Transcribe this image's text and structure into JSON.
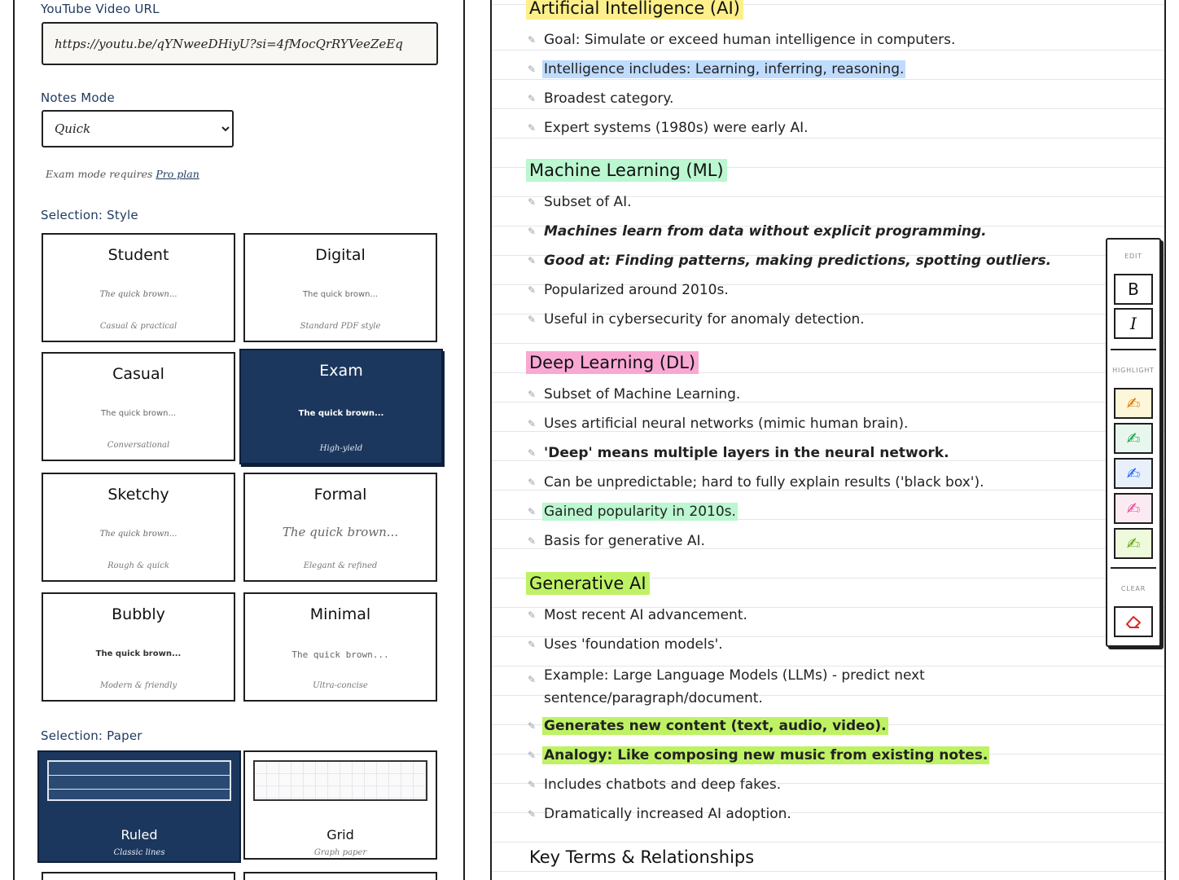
{
  "settings": {
    "url_label": "YouTube Video URL",
    "url_value": "https://youtu.be/qYNweeDHiyU?si=4fMocQrRYVeeZeEq",
    "mode_label": "Notes Mode",
    "mode_value": "Quick",
    "mode_note_prefix": "Exam mode requires",
    "mode_note_link": "Pro plan",
    "style_label": "Selection: Style",
    "paper_label": "Selection: Paper"
  },
  "styles": [
    {
      "name": "Student",
      "sample": "The quick brown...",
      "desc": "Casual & practical"
    },
    {
      "name": "Digital",
      "sample": "The quick brown...",
      "desc": "Standard PDF style"
    },
    {
      "name": "Casual",
      "sample": "The quick brown...",
      "desc": "Conversational"
    },
    {
      "name": "Exam",
      "sample": "The quick brown...",
      "desc": "High-yield",
      "selected": true
    },
    {
      "name": "Sketchy",
      "sample": "The quick brown...",
      "desc": "Rough & quick"
    },
    {
      "name": "Formal",
      "sample": "The quick brown...",
      "desc": "Elegant & refined"
    },
    {
      "name": "Bubbly",
      "sample": "The quick brown...",
      "desc": "Modern & friendly"
    },
    {
      "name": "Minimal",
      "sample": "The quick brown...",
      "desc": "Ultra-concise"
    }
  ],
  "papers": [
    {
      "name": "Ruled",
      "desc": "Classic lines",
      "selected": true
    },
    {
      "name": "Grid",
      "desc": "Graph paper"
    }
  ],
  "notes": {
    "h1": "Artificial Intelligence (AI)",
    "ai": [
      "Goal: Simulate or exceed human intelligence in computers.",
      "Intelligence includes: Learning, inferring, reasoning.",
      "Broadest category.",
      "Expert systems (1980s) were early AI."
    ],
    "h2": "Machine Learning (ML)",
    "ml": [
      "Subset of AI.",
      "Machines learn from data without explicit programming.",
      "Good at: Finding patterns, making predictions, spotting outliers.",
      "Popularized around 2010s.",
      "Useful in cybersecurity for anomaly detection."
    ],
    "h3": "Deep Learning (DL)",
    "dl": [
      "Subset of Machine Learning.",
      "Uses artificial neural networks (mimic human brain).",
      "'Deep' means multiple layers in the neural network.",
      "Can be unpredictable; hard to fully explain results ('black box').",
      "Gained popularity in 2010s.",
      "Basis for generative AI."
    ],
    "h4": "Generative AI",
    "gen": [
      "Most recent AI advancement.",
      "Uses 'foundation models'.",
      "Example: Large Language Models (LLMs) - predict next sentence/paragraph/document.",
      "Generates new content (text, audio, video).",
      "Analogy: Like composing new music from existing notes.",
      "Includes chatbots and deep fakes.",
      "Dramatically increased AI adoption."
    ],
    "h5": "Key Terms & Relationships"
  },
  "toolbar": {
    "edit_label": "EDIT",
    "bold": "B",
    "italic": "I",
    "highlight_label": "HIGHLIGHT",
    "clear_label": "CLEAR"
  },
  "colors": {
    "accent_navy": "#1c375e",
    "hl_yellow": "#fdf08a",
    "hl_green": "#bbf7d0",
    "hl_pink": "#f9a8d4",
    "hl_lime": "#bef264",
    "hl_blue": "#bfdbfe"
  }
}
